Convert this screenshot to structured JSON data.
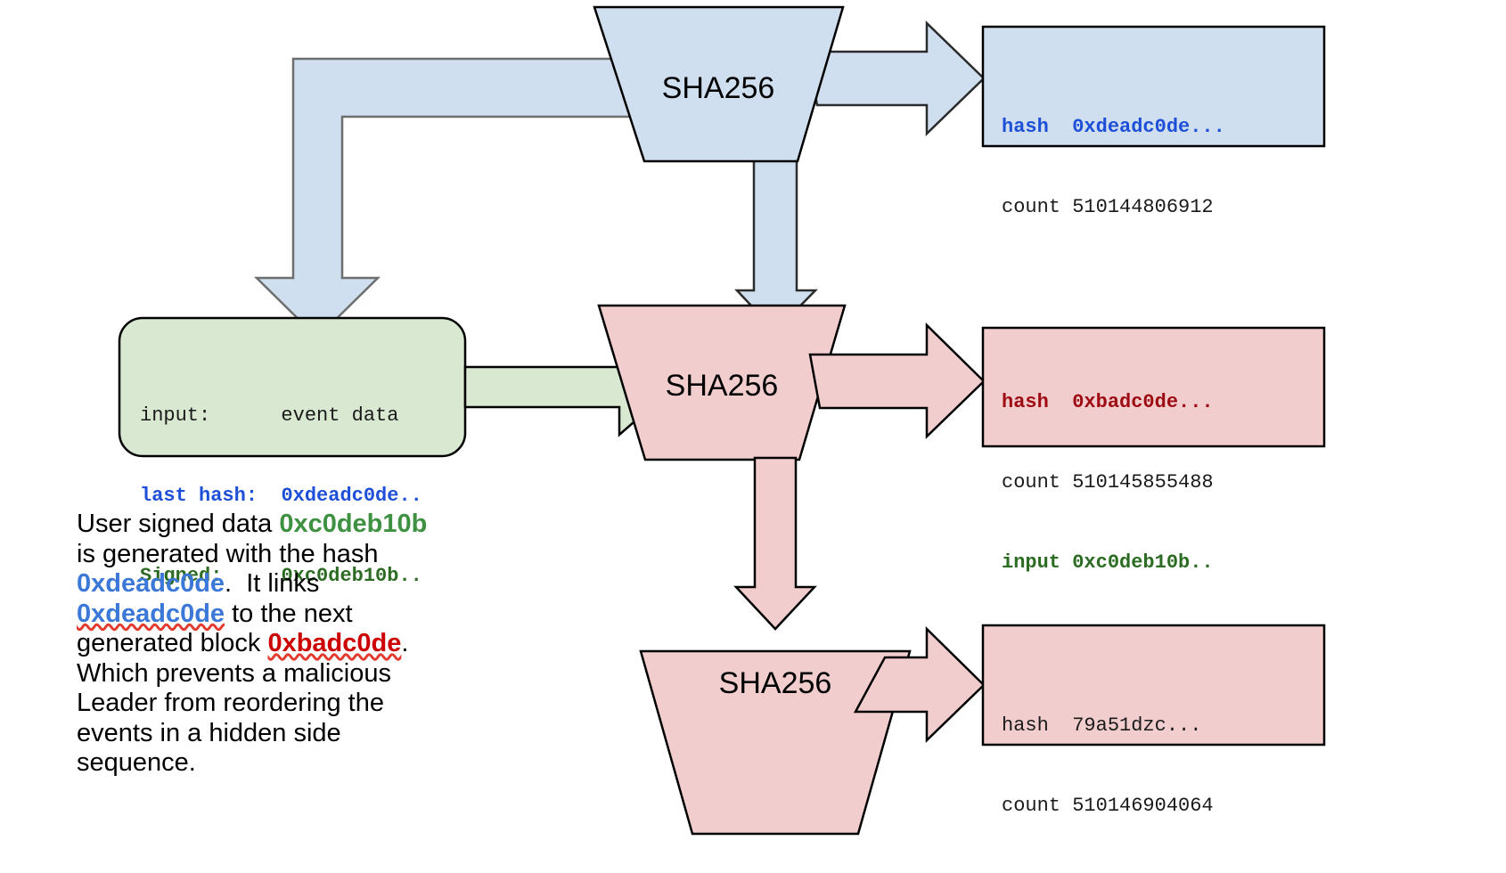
{
  "colors": {
    "blue_fill": "#cfdfef",
    "blue_stroke": "#5a5a5a",
    "pink_fill": "#f2cdce",
    "pink_stroke": "#000000",
    "green_fill": "#d9e8d0",
    "green_stroke": "#000000",
    "text_blue": "#1d4fd8",
    "text_red": "#9e0a12",
    "text_green": "#2b6b22",
    "para_green": "#3f9142",
    "para_blue": "#3b78d8",
    "para_red": "#cc0000",
    "spell_underline": "#e23b2e"
  },
  "processors": [
    {
      "id": "sha256-top",
      "label": "SHA256",
      "variant": "blue"
    },
    {
      "id": "sha256-middle",
      "label": "SHA256",
      "variant": "pink"
    },
    {
      "id": "sha256-bottom",
      "label": "SHA256",
      "variant": "pink"
    }
  ],
  "input_box": {
    "rows": [
      {
        "key": "input:",
        "value": "event data",
        "key_color": "plain",
        "value_color": "plain"
      },
      {
        "key": "last hash:",
        "value": "0xdeadc0de..",
        "key_color": "blue",
        "value_color": "blue"
      },
      {
        "key": "Signed:",
        "value": "0xc0deb10b..",
        "key_color": "green",
        "value_color": "green"
      }
    ],
    "line1": "input:      event data",
    "line2_key": "last hash:  ",
    "line2_val": "0xdeadc0de..",
    "line3_key": "Signed:     ",
    "line3_val": "0xc0deb10b.."
  },
  "output_boxes": [
    {
      "id": "output-top",
      "variant": "blue",
      "rows": [
        {
          "text": "hash  0xdeadc0de...",
          "color": "blue"
        },
        {
          "text": "count 510144806912",
          "color": "plain"
        }
      ]
    },
    {
      "id": "output-middle",
      "variant": "pink",
      "rows": [
        {
          "text": "hash  0xbadc0de...",
          "color": "red"
        },
        {
          "text": "count 510145855488",
          "color": "plain"
        },
        {
          "text": "input 0xc0deb10b..",
          "color": "green"
        }
      ]
    },
    {
      "id": "output-bottom",
      "variant": "pink",
      "rows": [
        {
          "text": "hash  79a51dzc...",
          "color": "plain"
        },
        {
          "text": "count 510146904064",
          "color": "plain"
        }
      ]
    }
  ],
  "caption": {
    "full_text": "User signed data 0xc0deb10b is generated with the hash 0xdeadc0de.  It links 0xdeadc0de to the next generated block 0xbadc0de. Which prevents a malicious Leader from reordering the events in a hidden side sequence.",
    "lines": [
      {
        "segments": [
          {
            "t": "User signed data ",
            "c": "plain"
          },
          {
            "t": "0xc0deb10b",
            "c": "green"
          }
        ]
      },
      {
        "segments": [
          {
            "t": "is generated with the hash",
            "c": "plain"
          }
        ]
      },
      {
        "segments": [
          {
            "t": "0xdeadc0de",
            "c": "blue"
          },
          {
            "t": ".  It links",
            "c": "plain"
          }
        ]
      },
      {
        "segments": [
          {
            "t": "0xdeadc0de",
            "c": "blue",
            "spell": true
          },
          {
            "t": " to the next",
            "c": "plain"
          }
        ]
      },
      {
        "segments": [
          {
            "t": "generated block ",
            "c": "plain"
          },
          {
            "t": "0xbadc0de",
            "c": "red",
            "spell": true
          },
          {
            "t": ".",
            "c": "plain"
          }
        ]
      },
      {
        "segments": [
          {
            "t": "Which prevents a malicious",
            "c": "plain"
          }
        ]
      },
      {
        "segments": [
          {
            "t": "Leader from reordering the",
            "c": "plain"
          }
        ]
      },
      {
        "segments": [
          {
            "t": "events in a hidden side",
            "c": "plain"
          }
        ]
      },
      {
        "segments": [
          {
            "t": "sequence.",
            "c": "plain"
          }
        ]
      }
    ]
  },
  "arrows": [
    {
      "id": "arrow-top-hash-to-output",
      "from": "sha256-top",
      "to": "output-top",
      "direction": "right",
      "color": "blue"
    },
    {
      "id": "arrow-top-hash-feedback",
      "from": "sha256-top",
      "to": "input-box",
      "direction": "elbow-left-down",
      "color": "blue"
    },
    {
      "id": "arrow-top-to-middle",
      "from": "sha256-top",
      "to": "sha256-middle",
      "direction": "down",
      "color": "blue"
    },
    {
      "id": "arrow-input-to-middle",
      "from": "input-box",
      "to": "sha256-middle",
      "direction": "right",
      "color": "green"
    },
    {
      "id": "arrow-middle-to-output",
      "from": "sha256-middle",
      "to": "output-middle",
      "direction": "right",
      "color": "pink"
    },
    {
      "id": "arrow-middle-to-bottom",
      "from": "sha256-middle",
      "to": "sha256-bottom",
      "direction": "down",
      "color": "pink"
    },
    {
      "id": "arrow-bottom-to-output",
      "from": "sha256-bottom",
      "to": "output-bottom",
      "direction": "right",
      "color": "pink"
    }
  ]
}
